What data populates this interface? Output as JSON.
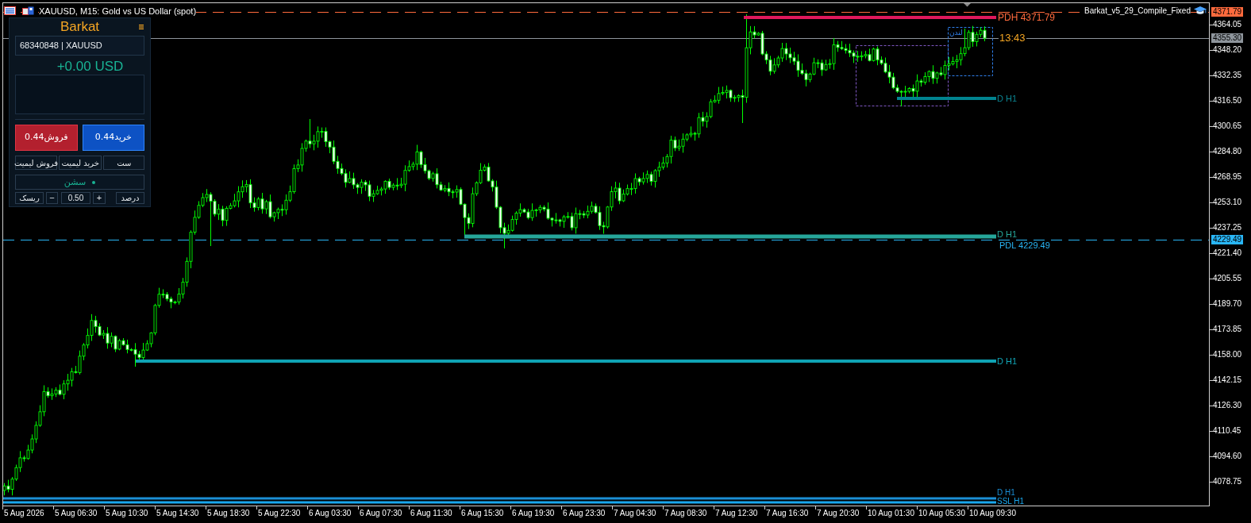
{
  "chart": {
    "title": "XAUUSD, M15: Gold vs US Dollar (spot)",
    "indicator": "Barkat_v5_29_Compile_Fixed",
    "timer": "13:43",
    "price_lines": [
      {
        "kind": "dashed",
        "tag": "4371.79",
        "color": "#ff6a3d"
      },
      {
        "kind": "solid",
        "tag": "4355.30",
        "color": "#8e959c"
      },
      {
        "kind": "dashed",
        "tag": "4229.49",
        "color": "#29b6f6"
      }
    ],
    "level_lines": [
      {
        "color": "#e0185c"
      },
      {
        "color": "#00838f"
      },
      {
        "color": "#26a69a"
      },
      {
        "color": "#0fa3b5"
      },
      {
        "color": "#1b8fd6"
      },
      {
        "color": "#19a7ee"
      }
    ],
    "level_labels": [
      {
        "text": "PDH 4371.79",
        "color": "#ff6a3d"
      },
      {
        "text": "D H1",
        "color": "#0b8592"
      },
      {
        "text": "D H1",
        "color": "#26a69a"
      },
      {
        "text": "PDL 4229.49",
        "color": "#29b6f6"
      },
      {
        "text": "D H1",
        "color": "#12a7b8"
      },
      {
        "text": "D H1",
        "color": "#1b8fd6"
      },
      {
        "text": "SSL H1",
        "color": "#19a7ee"
      }
    ],
    "sessions": [
      {
        "color": "#7e57c2"
      },
      {
        "label": "لندن",
        "color": "#2f80ed"
      }
    ],
    "price_axis": [
      "4364.05",
      "4348.20",
      "4332.35",
      "4316.50",
      "4300.65",
      "4284.80",
      "4268.95",
      "4253.10",
      "4237.25",
      "4221.40",
      "4205.55",
      "4189.70",
      "4173.85",
      "4158.00",
      "4142.15",
      "4126.30",
      "4110.45",
      "4094.60",
      "4078.75"
    ],
    "time_axis": [
      "5 Aug 2026",
      "5 Aug 06:30",
      "5 Aug 10:30",
      "5 Aug 14:30",
      "5 Aug 18:30",
      "5 Aug 22:30",
      "6 Aug 03:30",
      "6 Aug 07:30",
      "6 Aug 11:30",
      "6 Aug 15:30",
      "6 Aug 19:30",
      "6 Aug 23:30",
      "7 Aug 04:30",
      "7 Aug 08:30",
      "7 Aug 12:30",
      "7 Aug 16:30",
      "7 Aug 20:30",
      "10 Aug 01:30",
      "10 Aug 05:30",
      "10 Aug 09:30"
    ]
  },
  "panel": {
    "title": "Barkat",
    "account": "68340848 | XAUUSD",
    "pnl": "+0.00 USD",
    "sell": "فروش0.44",
    "buy": "خرید0.44",
    "order_buttons": [
      "ست",
      "خرید لیمیت",
      "فروش لیمیت"
    ],
    "session": "سشن",
    "risk": "ریسک",
    "minus": "−",
    "lot": "0.50",
    "plus": "+",
    "percent": "درصد"
  }
}
